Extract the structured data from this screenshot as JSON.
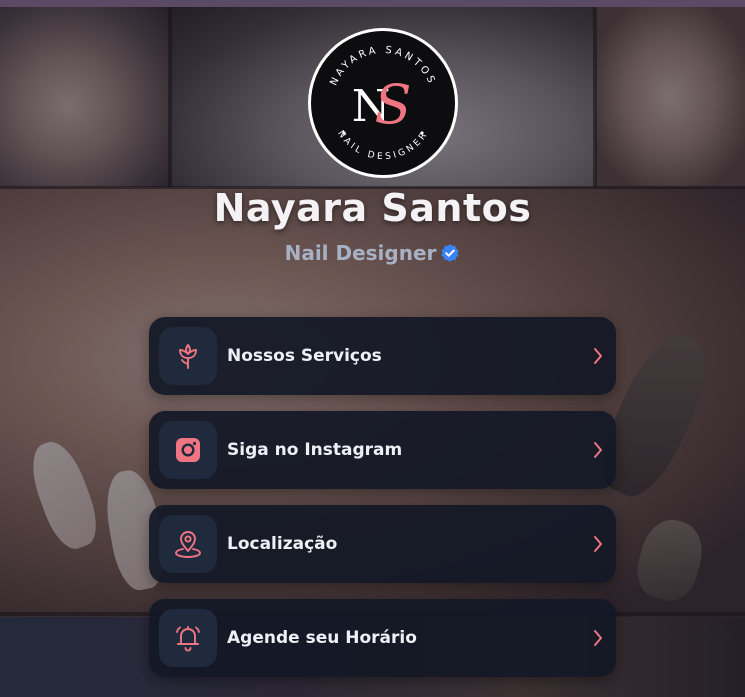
{
  "profile": {
    "name": "Nayara Santos",
    "subtitle": "Nail Designer",
    "logo_ring_top": "NAYARA SANTOS",
    "logo_ring_bottom": "NAIL DESIGNER",
    "logo_monogram": "NS"
  },
  "links": [
    {
      "label": "Nossos Serviços",
      "icon": "flower-icon"
    },
    {
      "label": "Siga no Instagram",
      "icon": "instagram-icon"
    },
    {
      "label": "Localização",
      "icon": "map-pin-icon"
    },
    {
      "label": "Agende seu Horário",
      "icon": "bell-icon"
    }
  ],
  "colors": {
    "accent": "#f07582",
    "verified": "#3b82f6",
    "card_bg": "#131826",
    "icon_bg": "#1f2a3d"
  }
}
